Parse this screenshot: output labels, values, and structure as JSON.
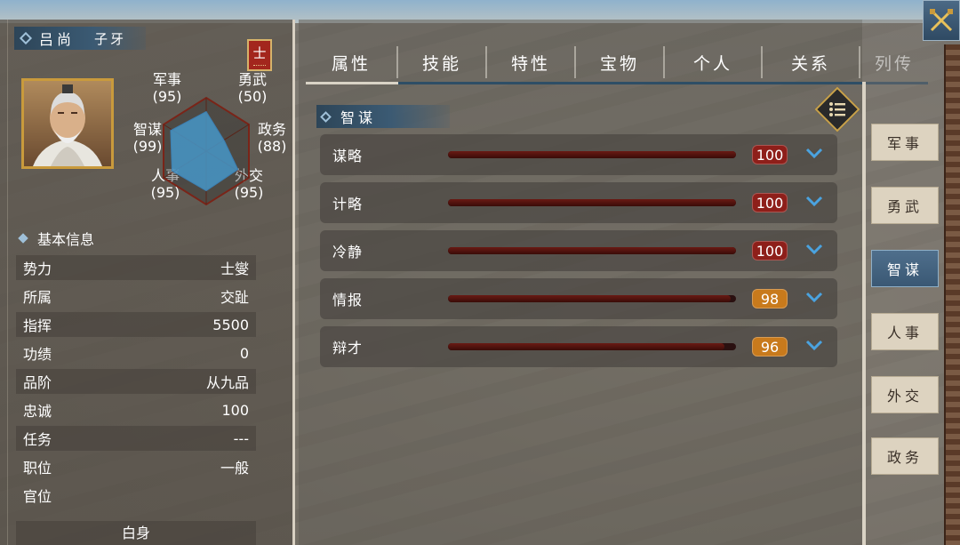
{
  "character": {
    "name": "吕尚",
    "courtesy_name": "子牙",
    "faction_badge": "士",
    "stats": {
      "military": {
        "label": "军事",
        "value": "(95)"
      },
      "valor": {
        "label": "勇武",
        "value": "(50)"
      },
      "intellect": {
        "label": "智谋",
        "value": "(99)"
      },
      "politics": {
        "label": "政务",
        "value": "(88)"
      },
      "personnel": {
        "label": "人事",
        "value": "(95)"
      },
      "diplomacy": {
        "label": "外交",
        "value": "(95)"
      }
    },
    "radar_values": [
      95,
      50,
      88,
      95,
      95,
      99
    ]
  },
  "basic_info": {
    "title": "基本信息",
    "rows": [
      {
        "label": "势力",
        "value": "士燮"
      },
      {
        "label": "所属",
        "value": "交趾"
      },
      {
        "label": "指挥",
        "value": "5500"
      },
      {
        "label": "功绩",
        "value": "0"
      },
      {
        "label": "品阶",
        "value": "从九品"
      },
      {
        "label": "忠诚",
        "value": "100"
      },
      {
        "label": "任务",
        "value": "---"
      },
      {
        "label": "职位",
        "value": "一般"
      },
      {
        "label": "官位",
        "value": ""
      }
    ],
    "rank_title": "白身"
  },
  "tabs": [
    {
      "label": "属性",
      "active": true
    },
    {
      "label": "技能"
    },
    {
      "label": "特性"
    },
    {
      "label": "宝物"
    },
    {
      "label": "个人"
    },
    {
      "label": "关系"
    },
    {
      "label": "列传"
    }
  ],
  "section": {
    "title": "智谋"
  },
  "skills": [
    {
      "name": "谋略",
      "value": "100",
      "fraction": 1.0,
      "badge_color": "#8e1f1a"
    },
    {
      "name": "计略",
      "value": "100",
      "fraction": 1.0,
      "badge_color": "#8e1f1a"
    },
    {
      "name": "冷静",
      "value": "100",
      "fraction": 1.0,
      "badge_color": "#8e1f1a"
    },
    {
      "name": "情报",
      "value": "98",
      "fraction": 0.98,
      "badge_color": "#c87a1c"
    },
    {
      "name": "辩才",
      "value": "96",
      "fraction": 0.96,
      "badge_color": "#c87a1c"
    }
  ],
  "side_tabs": [
    {
      "label": "军事"
    },
    {
      "label": "勇武"
    },
    {
      "label": "智谋",
      "active": true
    },
    {
      "label": "人事"
    },
    {
      "label": "外交"
    },
    {
      "label": "政务"
    }
  ],
  "icons": {
    "close": "crossed-swords-icon",
    "menu": "list-menu-icon",
    "expand": "chevron-down-icon"
  },
  "colors": {
    "accent_blue": "#3b5a73",
    "chevron": "#4aa3e0",
    "gold": "#c99a3c"
  }
}
